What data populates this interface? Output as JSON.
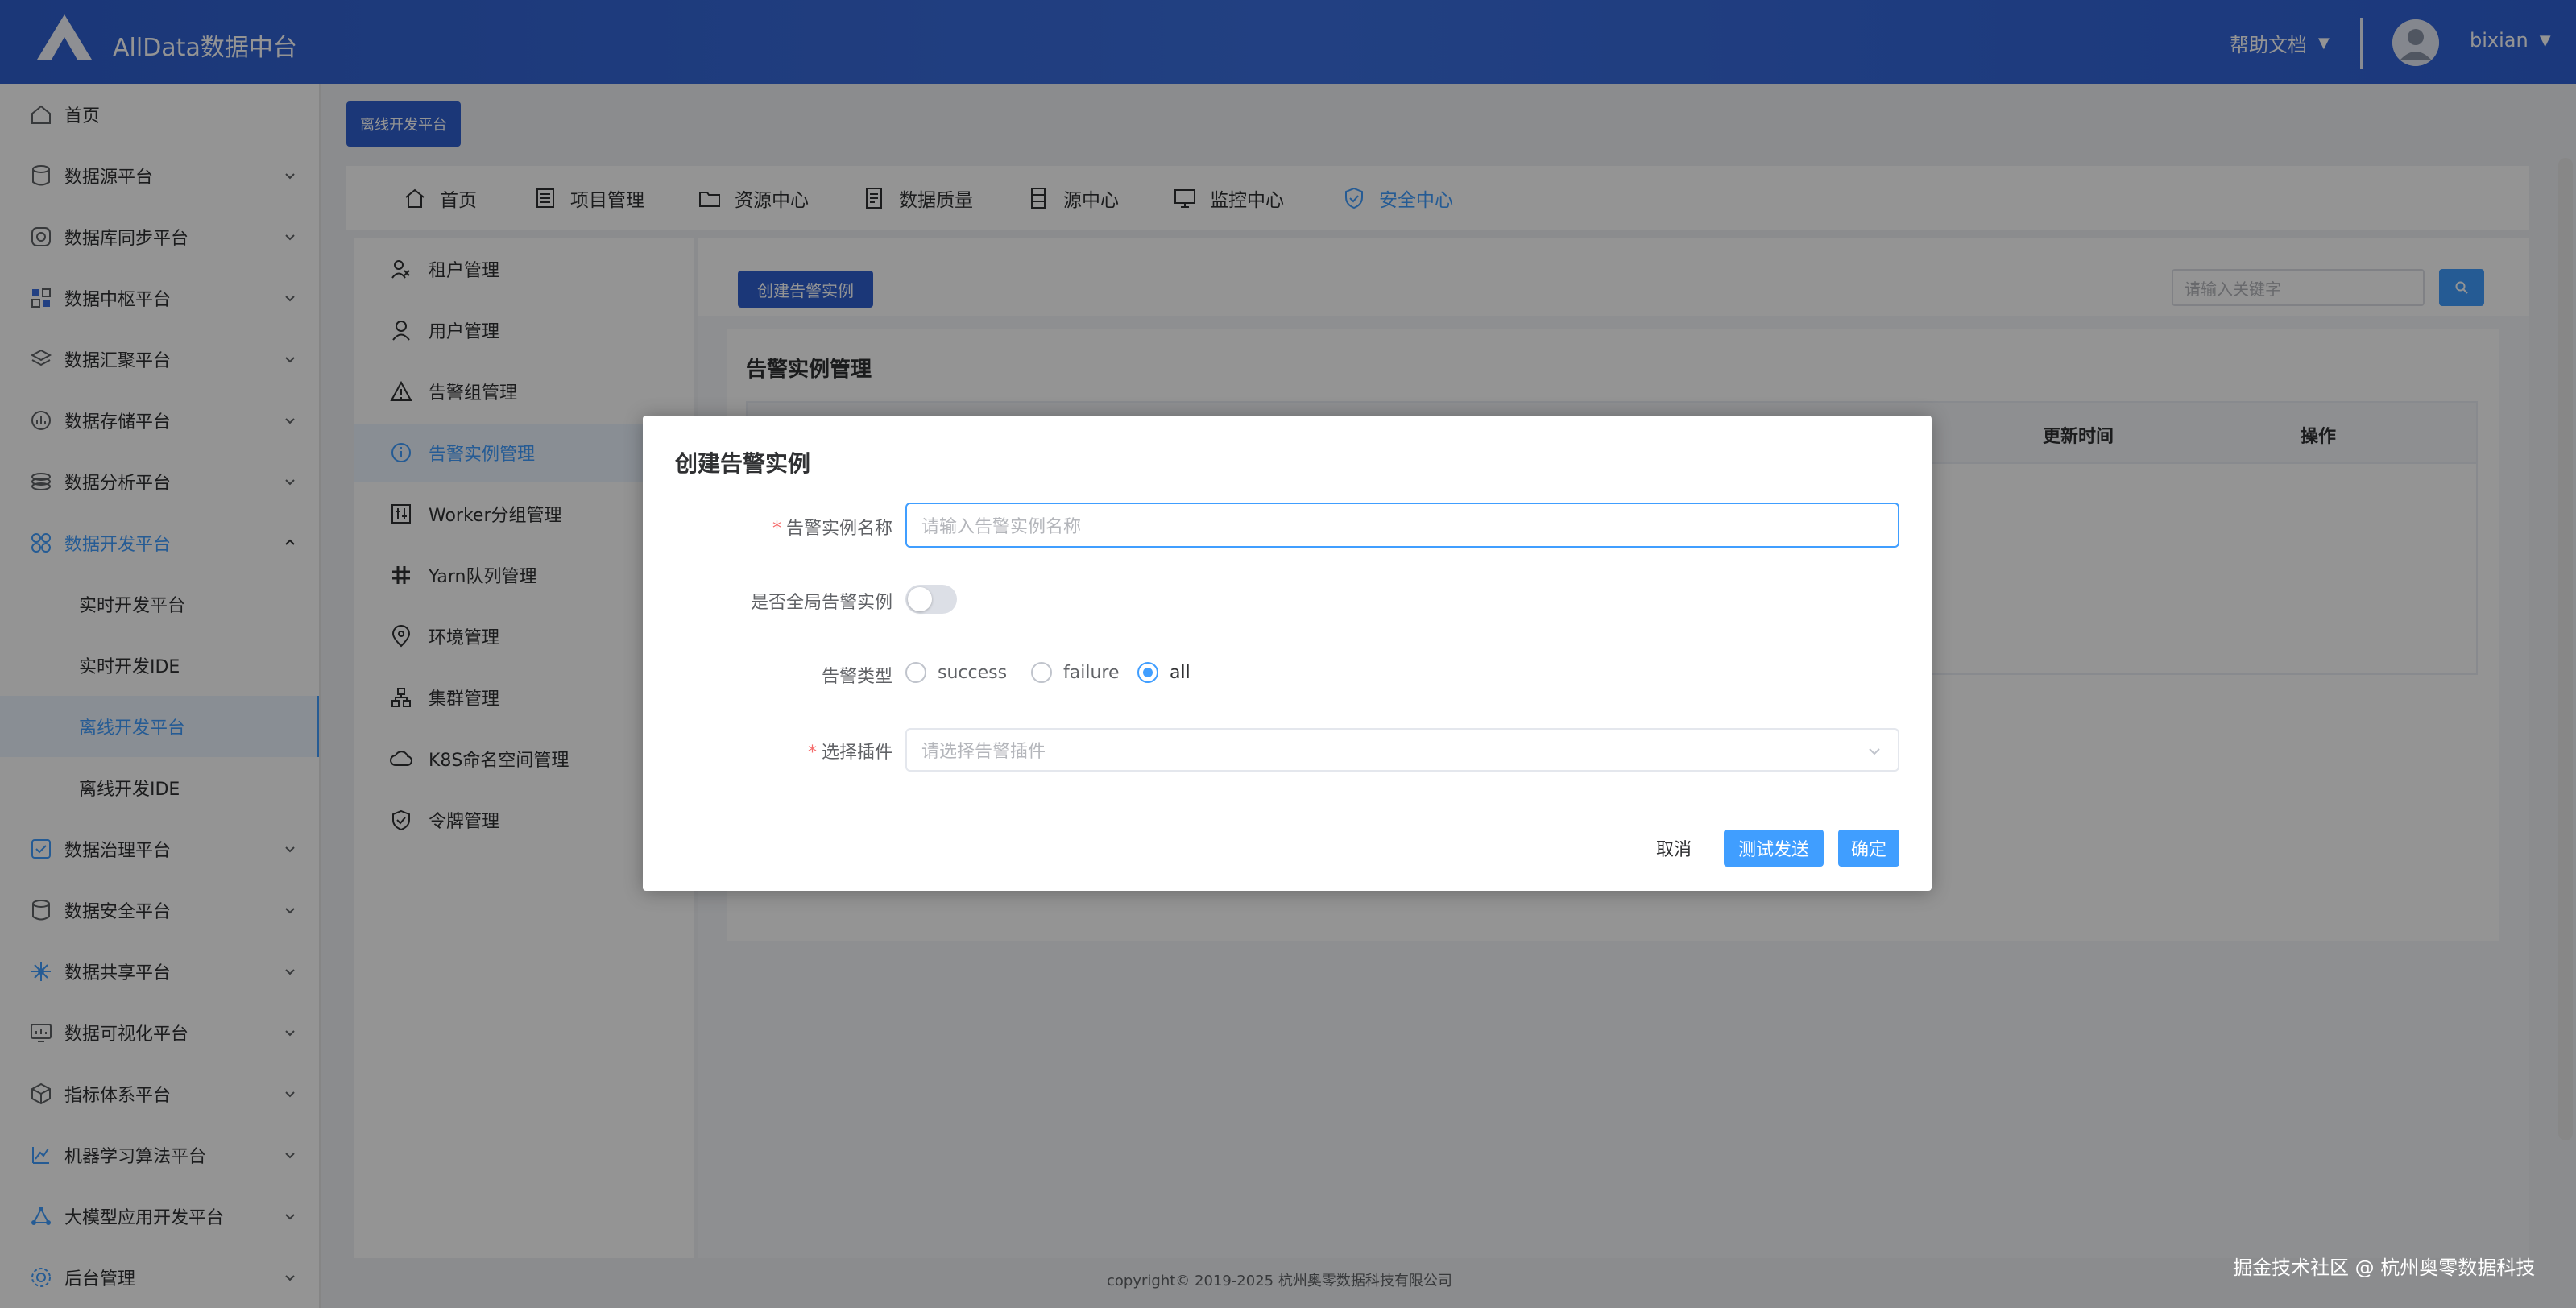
{
  "app": {
    "title": "AllData数据中台"
  },
  "header": {
    "help_label": "帮助文档",
    "username": "bixian"
  },
  "sidebar": {
    "items": [
      {
        "label": "首页"
      },
      {
        "label": "数据源平台"
      },
      {
        "label": "数据库同步平台"
      },
      {
        "label": "数据中枢平台"
      },
      {
        "label": "数据汇聚平台"
      },
      {
        "label": "数据存储平台"
      },
      {
        "label": "数据分析平台"
      },
      {
        "label": "数据开发平台"
      },
      {
        "label": "实时开发平台"
      },
      {
        "label": "实时开发IDE"
      },
      {
        "label": "离线开发平台"
      },
      {
        "label": "离线开发IDE"
      },
      {
        "label": "数据治理平台"
      },
      {
        "label": "数据安全平台"
      },
      {
        "label": "数据共享平台"
      },
      {
        "label": "数据可视化平台"
      },
      {
        "label": "指标体系平台"
      },
      {
        "label": "机器学习算法平台"
      },
      {
        "label": "大模型应用开发平台"
      },
      {
        "label": "后台管理"
      }
    ]
  },
  "breadcrumb": {
    "tag": "离线开发平台"
  },
  "topnav": {
    "items": [
      {
        "label": "首页"
      },
      {
        "label": "项目管理"
      },
      {
        "label": "资源中心"
      },
      {
        "label": "数据质量"
      },
      {
        "label": "源中心"
      },
      {
        "label": "监控中心"
      },
      {
        "label": "安全中心"
      }
    ]
  },
  "security_menu": {
    "items": [
      {
        "label": "租户管理"
      },
      {
        "label": "用户管理"
      },
      {
        "label": "告警组管理"
      },
      {
        "label": "告警实例管理"
      },
      {
        "label": "Worker分组管理"
      },
      {
        "label": "Yarn队列管理"
      },
      {
        "label": "环境管理"
      },
      {
        "label": "集群管理"
      },
      {
        "label": "K8S命名空间管理"
      },
      {
        "label": "令牌管理"
      }
    ]
  },
  "content": {
    "create_button": "创建告警实例",
    "search_placeholder": "请输入关键字",
    "card_title": "告警实例管理",
    "table_headers": [
      "更新时间",
      "操作"
    ]
  },
  "footer": {
    "copyright": "copyright© 2019-2025 杭州奥零数据科技有限公司"
  },
  "watermark": "掘金技术社区 @ 杭州奥零数据科技",
  "dialog": {
    "title": "创建告警实例",
    "name_label": "告警实例名称",
    "name_placeholder": "请输入告警实例名称",
    "global_label": "是否全局告警实例",
    "global_on": false,
    "type_label": "告警类型",
    "type_options": [
      "success",
      "failure",
      "all"
    ],
    "type_selected": "all",
    "plugin_label": "选择插件",
    "plugin_placeholder": "请选择告警插件",
    "cancel": "取消",
    "test_send": "测试发送",
    "confirm": "确定"
  },
  "colors": {
    "primary": "#409eff",
    "header": "#2f5fcf",
    "required": "#f56c6c"
  }
}
